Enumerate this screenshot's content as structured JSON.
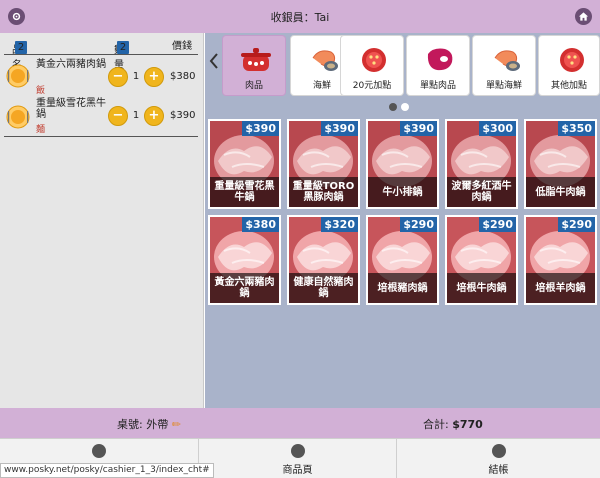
{
  "header": {
    "title": "收銀員：Tai",
    "settings_icon": "gear-icon",
    "home_icon": "home-icon"
  },
  "order": {
    "col_name": "品名",
    "name_count": "2",
    "col_qty": "數量",
    "qty_count": "2",
    "col_price": "價錢",
    "items": [
      {
        "name": "黃金六兩豬肉鍋",
        "note": "飯",
        "qty": "1",
        "price": "$380"
      },
      {
        "name": "重量級雪花黑牛鍋",
        "note": "麵",
        "qty": "1",
        "price": "$390"
      }
    ]
  },
  "categories": [
    {
      "label": "肉品",
      "icon": "pot-icon",
      "active": true
    },
    {
      "label": "海鮮",
      "icon": "shrimp-icon"
    },
    {
      "label": "20元加點",
      "icon": "tomato-icon"
    },
    {
      "label": "單點肉品",
      "icon": "steak-icon"
    },
    {
      "label": "單點海鮮",
      "icon": "shrimp-icon"
    },
    {
      "label": "其他加點",
      "icon": "tomato-icon"
    }
  ],
  "products": [
    {
      "price": "$390",
      "name": "重量級雪花黑牛鍋"
    },
    {
      "price": "$390",
      "name": "重量級TORO黑豚肉鍋"
    },
    {
      "price": "$390",
      "name": "牛小排鍋"
    },
    {
      "price": "$300",
      "name": "波爾多紅酒牛肉鍋"
    },
    {
      "price": "$350",
      "name": "低脂牛肉鍋"
    },
    {
      "price": "$380",
      "name": "黃金六兩豬肉鍋"
    },
    {
      "price": "$320",
      "name": "健康自然豬肉鍋"
    },
    {
      "price": "$290",
      "name": "培根豬肉鍋"
    },
    {
      "price": "$290",
      "name": "培根牛肉鍋"
    },
    {
      "price": "$290",
      "name": "培根羊肉鍋"
    }
  ],
  "summary": {
    "table_label": "桌號: 外帶",
    "total_label": "合計:",
    "total_value": "$770"
  },
  "footer": {
    "back_icon": "back-icon",
    "products_label": "商品頁",
    "checkout_label": "結帳"
  },
  "status_url": "www.posky.net/posky/cashier_1_3/index_cht#",
  "colors": {
    "header": "#d2b0d6",
    "price_badge": "#2364a8",
    "qty_button": "#f0b51d",
    "right_bg": "#a9b3ca"
  }
}
